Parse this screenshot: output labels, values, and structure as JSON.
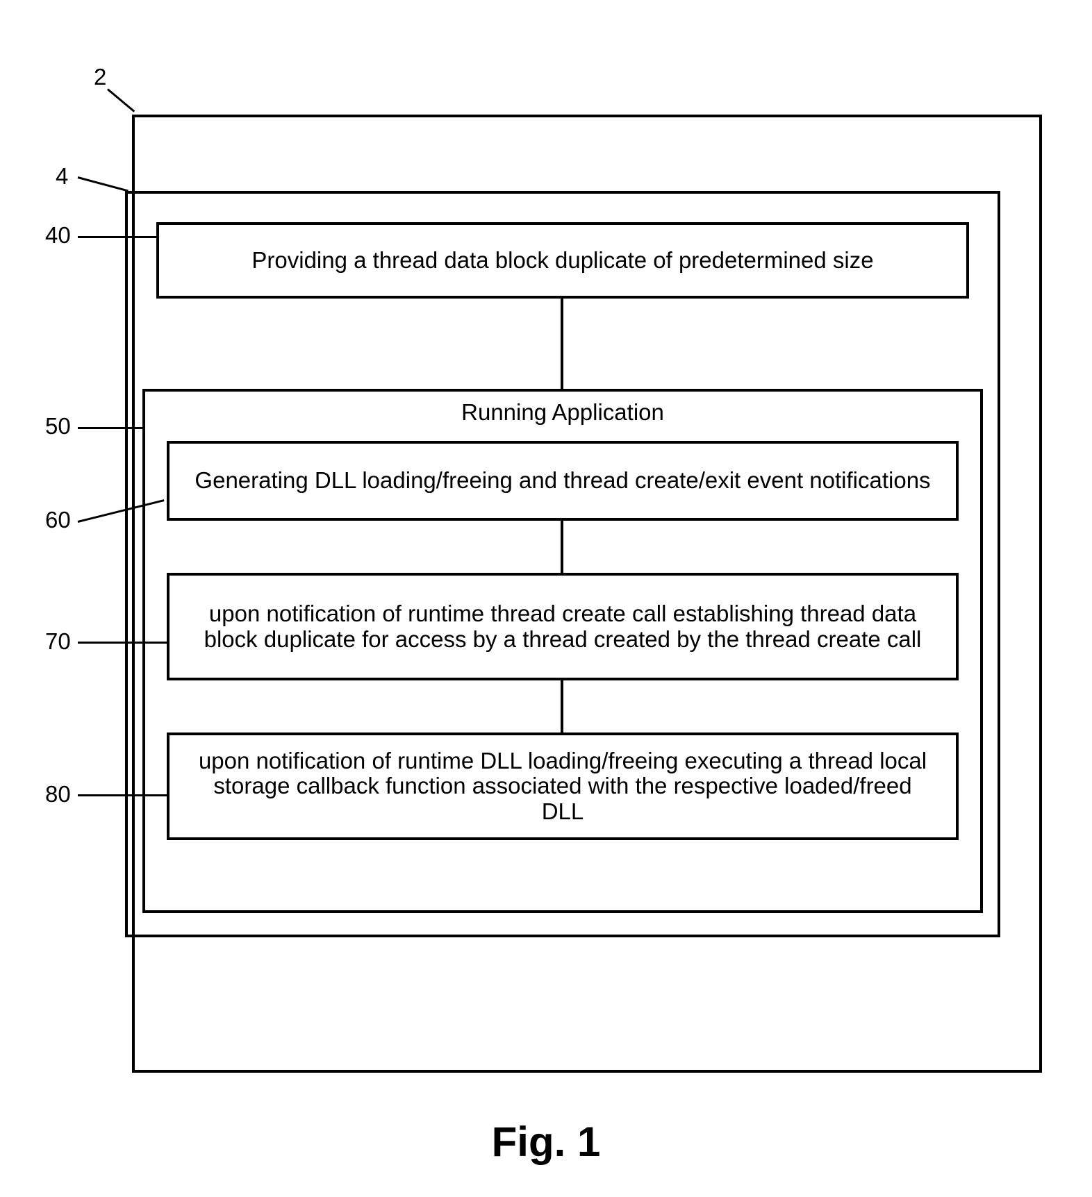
{
  "labels": {
    "l2": "2",
    "l4": "4",
    "l40": "40",
    "l50": "50",
    "l60": "60",
    "l70": "70",
    "l80": "80"
  },
  "boxes": {
    "b40": "Providing a thread data block duplicate of predetermined size",
    "b50_title": "Running Application",
    "b60": "Generating DLL loading/freeing and thread create/exit event notifications",
    "b70": "upon notification of runtime thread create call establishing thread data block duplicate for access by a thread created by the thread create call",
    "b80": "upon notification of runtime DLL loading/freeing executing a thread local storage callback function associated with the respective loaded/freed DLL"
  },
  "caption": "Fig. 1"
}
